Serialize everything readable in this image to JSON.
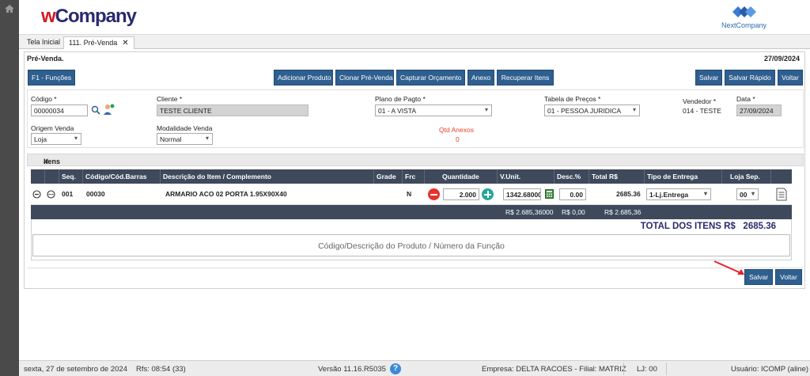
{
  "brand": {
    "logo_w": "w",
    "logo_rest": "Company",
    "partner": "NextCompany"
  },
  "tabs": [
    {
      "label": "Tela Inicial"
    },
    {
      "label": "111. Pré-Venda",
      "close": "✕"
    }
  ],
  "panel": {
    "title": "Pré-Venda.",
    "date": "27/09/2024"
  },
  "toolbar": {
    "f1": "F1 - Funções",
    "adicionar": "Adicionar Produto",
    "clonar": "Clonar Pré-Venda",
    "capturar": "Capturar Orçamento",
    "anexo": "Anexo",
    "recuperar": "Recuperar Itens",
    "salvar": "Salvar",
    "salvar_rapido": "Salvar Rápido",
    "voltar": "Voltar"
  },
  "form": {
    "codigo_label": "Código *",
    "codigo_value": "00000034",
    "cliente_label": "Cliente *",
    "cliente_value": "TESTE CLIENTE",
    "plano_label": "Plano de Pagto *",
    "plano_value": "01 - A VISTA",
    "tabela_label": "Tabela de Preços *",
    "tabela_value": "01 - PESSOA JURIDICA",
    "vendedor_label": "Vendedor *",
    "vendedor_value": "014 - TESTE",
    "data_label": "Data *",
    "data_value": "27/09/2024",
    "origem_label": "Origem Venda",
    "origem_value": "Loja",
    "modalidade_label": "Modalidade Venda",
    "modalidade_value": "Normal",
    "qtd_anexos_label": "Qtd Anexos",
    "qtd_anexos_value": "0"
  },
  "items_section": {
    "title": "Itens"
  },
  "grid": {
    "headers": [
      "Seq.",
      "Código/Cód.Barras",
      "Descrição do Item / Complemento",
      "Grade",
      "Frc",
      "Quantidade",
      "V.Unit.",
      "Desc.%",
      "Total R$",
      "Tipo de Entrega",
      "Loja Sep."
    ],
    "row": {
      "seq": "001",
      "codigo": "00030",
      "descricao": "ARMARIO ACO 02 PORTA 1.95X90X40",
      "frc": "N",
      "quantidade": "2.000",
      "vunit": "1342.68000",
      "desc": "0.00",
      "total": "2685.36",
      "entrega": "1-Lj.Entrega",
      "loja": "00"
    },
    "totals": {
      "vunit": "R$ 2.685,36000",
      "desc": "R$ 0,00",
      "total": "R$ 2.685,36"
    },
    "total_label": "TOTAL DOS ITENS R$",
    "total_value": "2685.36",
    "search_placeholder": "Código/Descrição do Produto / Número da Função"
  },
  "bottom": {
    "salvar": "Salvar",
    "voltar": "Voltar"
  },
  "footer": {
    "date": "sexta, 27 de setembro de 2024",
    "rfs": "Rfs: 08:54 (33)",
    "versao": "Versão 11.16.R5035",
    "empresa": "Empresa: DELTA RACOES - Filial: MATRIZ",
    "lj": "LJ: 00",
    "usuario": "Usuário: ICOMP (aline)"
  },
  "colors": {
    "button": "#2f5f8f",
    "grid_header": "#3e4a5c",
    "red": "#e8412c",
    "green": "#26a69a"
  }
}
